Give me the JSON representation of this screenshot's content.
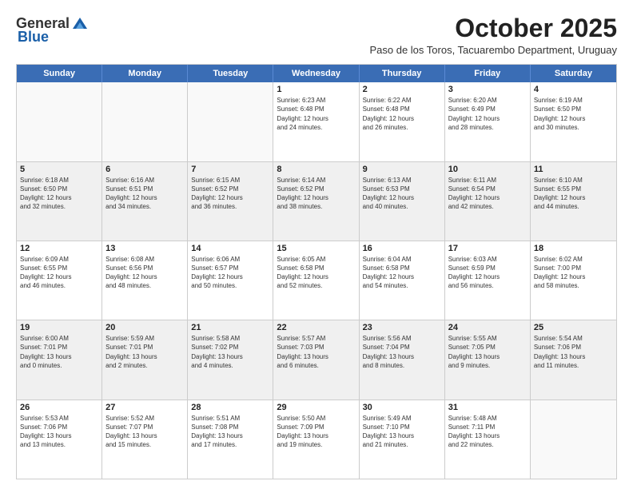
{
  "logo": {
    "general": "General",
    "blue": "Blue"
  },
  "title": "October 2025",
  "subtitle": "Paso de los Toros, Tacuarembo Department, Uruguay",
  "days": [
    "Sunday",
    "Monday",
    "Tuesday",
    "Wednesday",
    "Thursday",
    "Friday",
    "Saturday"
  ],
  "rows": [
    [
      {
        "day": "",
        "info": ""
      },
      {
        "day": "",
        "info": ""
      },
      {
        "day": "",
        "info": ""
      },
      {
        "day": "1",
        "info": "Sunrise: 6:23 AM\nSunset: 6:48 PM\nDaylight: 12 hours\nand 24 minutes."
      },
      {
        "day": "2",
        "info": "Sunrise: 6:22 AM\nSunset: 6:48 PM\nDaylight: 12 hours\nand 26 minutes."
      },
      {
        "day": "3",
        "info": "Sunrise: 6:20 AM\nSunset: 6:49 PM\nDaylight: 12 hours\nand 28 minutes."
      },
      {
        "day": "4",
        "info": "Sunrise: 6:19 AM\nSunset: 6:50 PM\nDaylight: 12 hours\nand 30 minutes."
      }
    ],
    [
      {
        "day": "5",
        "info": "Sunrise: 6:18 AM\nSunset: 6:50 PM\nDaylight: 12 hours\nand 32 minutes."
      },
      {
        "day": "6",
        "info": "Sunrise: 6:16 AM\nSunset: 6:51 PM\nDaylight: 12 hours\nand 34 minutes."
      },
      {
        "day": "7",
        "info": "Sunrise: 6:15 AM\nSunset: 6:52 PM\nDaylight: 12 hours\nand 36 minutes."
      },
      {
        "day": "8",
        "info": "Sunrise: 6:14 AM\nSunset: 6:52 PM\nDaylight: 12 hours\nand 38 minutes."
      },
      {
        "day": "9",
        "info": "Sunrise: 6:13 AM\nSunset: 6:53 PM\nDaylight: 12 hours\nand 40 minutes."
      },
      {
        "day": "10",
        "info": "Sunrise: 6:11 AM\nSunset: 6:54 PM\nDaylight: 12 hours\nand 42 minutes."
      },
      {
        "day": "11",
        "info": "Sunrise: 6:10 AM\nSunset: 6:55 PM\nDaylight: 12 hours\nand 44 minutes."
      }
    ],
    [
      {
        "day": "12",
        "info": "Sunrise: 6:09 AM\nSunset: 6:55 PM\nDaylight: 12 hours\nand 46 minutes."
      },
      {
        "day": "13",
        "info": "Sunrise: 6:08 AM\nSunset: 6:56 PM\nDaylight: 12 hours\nand 48 minutes."
      },
      {
        "day": "14",
        "info": "Sunrise: 6:06 AM\nSunset: 6:57 PM\nDaylight: 12 hours\nand 50 minutes."
      },
      {
        "day": "15",
        "info": "Sunrise: 6:05 AM\nSunset: 6:58 PM\nDaylight: 12 hours\nand 52 minutes."
      },
      {
        "day": "16",
        "info": "Sunrise: 6:04 AM\nSunset: 6:58 PM\nDaylight: 12 hours\nand 54 minutes."
      },
      {
        "day": "17",
        "info": "Sunrise: 6:03 AM\nSunset: 6:59 PM\nDaylight: 12 hours\nand 56 minutes."
      },
      {
        "day": "18",
        "info": "Sunrise: 6:02 AM\nSunset: 7:00 PM\nDaylight: 12 hours\nand 58 minutes."
      }
    ],
    [
      {
        "day": "19",
        "info": "Sunrise: 6:00 AM\nSunset: 7:01 PM\nDaylight: 13 hours\nand 0 minutes."
      },
      {
        "day": "20",
        "info": "Sunrise: 5:59 AM\nSunset: 7:01 PM\nDaylight: 13 hours\nand 2 minutes."
      },
      {
        "day": "21",
        "info": "Sunrise: 5:58 AM\nSunset: 7:02 PM\nDaylight: 13 hours\nand 4 minutes."
      },
      {
        "day": "22",
        "info": "Sunrise: 5:57 AM\nSunset: 7:03 PM\nDaylight: 13 hours\nand 6 minutes."
      },
      {
        "day": "23",
        "info": "Sunrise: 5:56 AM\nSunset: 7:04 PM\nDaylight: 13 hours\nand 8 minutes."
      },
      {
        "day": "24",
        "info": "Sunrise: 5:55 AM\nSunset: 7:05 PM\nDaylight: 13 hours\nand 9 minutes."
      },
      {
        "day": "25",
        "info": "Sunrise: 5:54 AM\nSunset: 7:06 PM\nDaylight: 13 hours\nand 11 minutes."
      }
    ],
    [
      {
        "day": "26",
        "info": "Sunrise: 5:53 AM\nSunset: 7:06 PM\nDaylight: 13 hours\nand 13 minutes."
      },
      {
        "day": "27",
        "info": "Sunrise: 5:52 AM\nSunset: 7:07 PM\nDaylight: 13 hours\nand 15 minutes."
      },
      {
        "day": "28",
        "info": "Sunrise: 5:51 AM\nSunset: 7:08 PM\nDaylight: 13 hours\nand 17 minutes."
      },
      {
        "day": "29",
        "info": "Sunrise: 5:50 AM\nSunset: 7:09 PM\nDaylight: 13 hours\nand 19 minutes."
      },
      {
        "day": "30",
        "info": "Sunrise: 5:49 AM\nSunset: 7:10 PM\nDaylight: 13 hours\nand 21 minutes."
      },
      {
        "day": "31",
        "info": "Sunrise: 5:48 AM\nSunset: 7:11 PM\nDaylight: 13 hours\nand 22 minutes."
      },
      {
        "day": "",
        "info": ""
      }
    ]
  ]
}
